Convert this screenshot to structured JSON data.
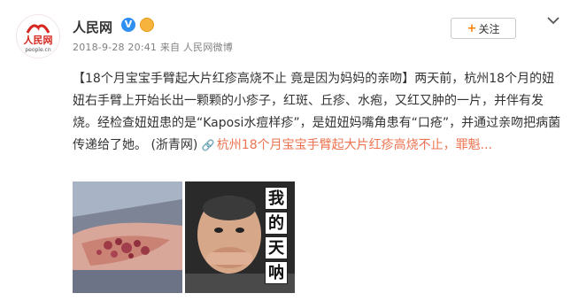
{
  "header": {
    "author": "人民网",
    "meta": "2018-9-28 20:41 来自 人民网微博",
    "verified_badge": "V",
    "follow_label": "关注",
    "follow_plus": "+"
  },
  "logo": {
    "text": "人民网",
    "url": "people.cn"
  },
  "post": {
    "body": "【18个月宝宝手臂起大片红疹高烧不止 竟是因为妈妈的亲吻】两天前，杭州18个月的妞妞右手臂上开始长出一颗颗的小疹子，红斑、丘疹、水疱，又红又肿的一片，并伴有发烧。经检查妞妞患的是“Kaposi水痘样疹”，是妞妞妈嘴角患有“口疮”，并通过亲吻把病菌传递给了她。 (浙青网) ",
    "link_icon": "🔗",
    "link_text": "杭州18个月宝宝手臂起大片红疹高烧不止，罪魁...",
    "link_color": "#eb7350"
  },
  "images": {
    "meme_text": [
      "我",
      "的",
      "天",
      "呐"
    ]
  }
}
